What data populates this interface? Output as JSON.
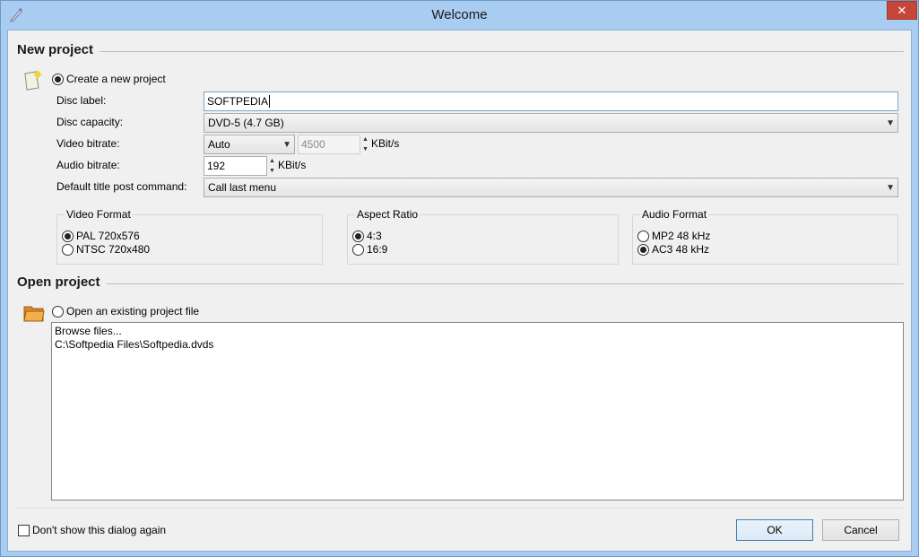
{
  "window": {
    "title": "Welcome",
    "close_glyph": "✕"
  },
  "new_project": {
    "section_title": "New project",
    "create_option_label": "Create a new project",
    "disc_label_caption": "Disc label:",
    "disc_label_value": "SOFTPEDIA",
    "disc_capacity_caption": "Disc capacity:",
    "disc_capacity_value": "DVD-5 (4.7 GB)",
    "video_bitrate_caption": "Video bitrate:",
    "video_bitrate_mode": "Auto",
    "video_bitrate_value": "4500",
    "video_bitrate_unit": "KBit/s",
    "audio_bitrate_caption": "Audio bitrate:",
    "audio_bitrate_value": "192",
    "audio_bitrate_unit": "KBit/s",
    "post_command_caption": "Default title post command:",
    "post_command_value": "Call last menu",
    "video_format": {
      "title": "Video Format",
      "options": [
        "PAL 720x576",
        "NTSC 720x480"
      ],
      "selected": "PAL 720x576"
    },
    "aspect_ratio": {
      "title": "Aspect Ratio",
      "options": [
        "4:3",
        "16:9"
      ],
      "selected": "4:3"
    },
    "audio_format": {
      "title": "Audio Format",
      "options": [
        "MP2 48 kHz",
        "AC3 48 kHz"
      ],
      "selected": "AC3 48 kHz"
    }
  },
  "open_project": {
    "section_title": "Open project",
    "open_option_label": "Open an existing project file",
    "files": [
      "Browse files...",
      "C:\\Softpedia Files\\Softpedia.dvds"
    ]
  },
  "footer": {
    "dont_show_label": "Don't show this dialog again",
    "ok_label": "OK",
    "cancel_label": "Cancel"
  },
  "icons": {
    "app": "pen-icon",
    "new_project": "new-document-icon",
    "open_project": "folder-icon"
  },
  "colors": {
    "title_bar": "#a9cdf1",
    "close_button": "#c7463a",
    "dialog_bg": "#f0f0f0",
    "default_button_border": "#3c7fb1"
  }
}
